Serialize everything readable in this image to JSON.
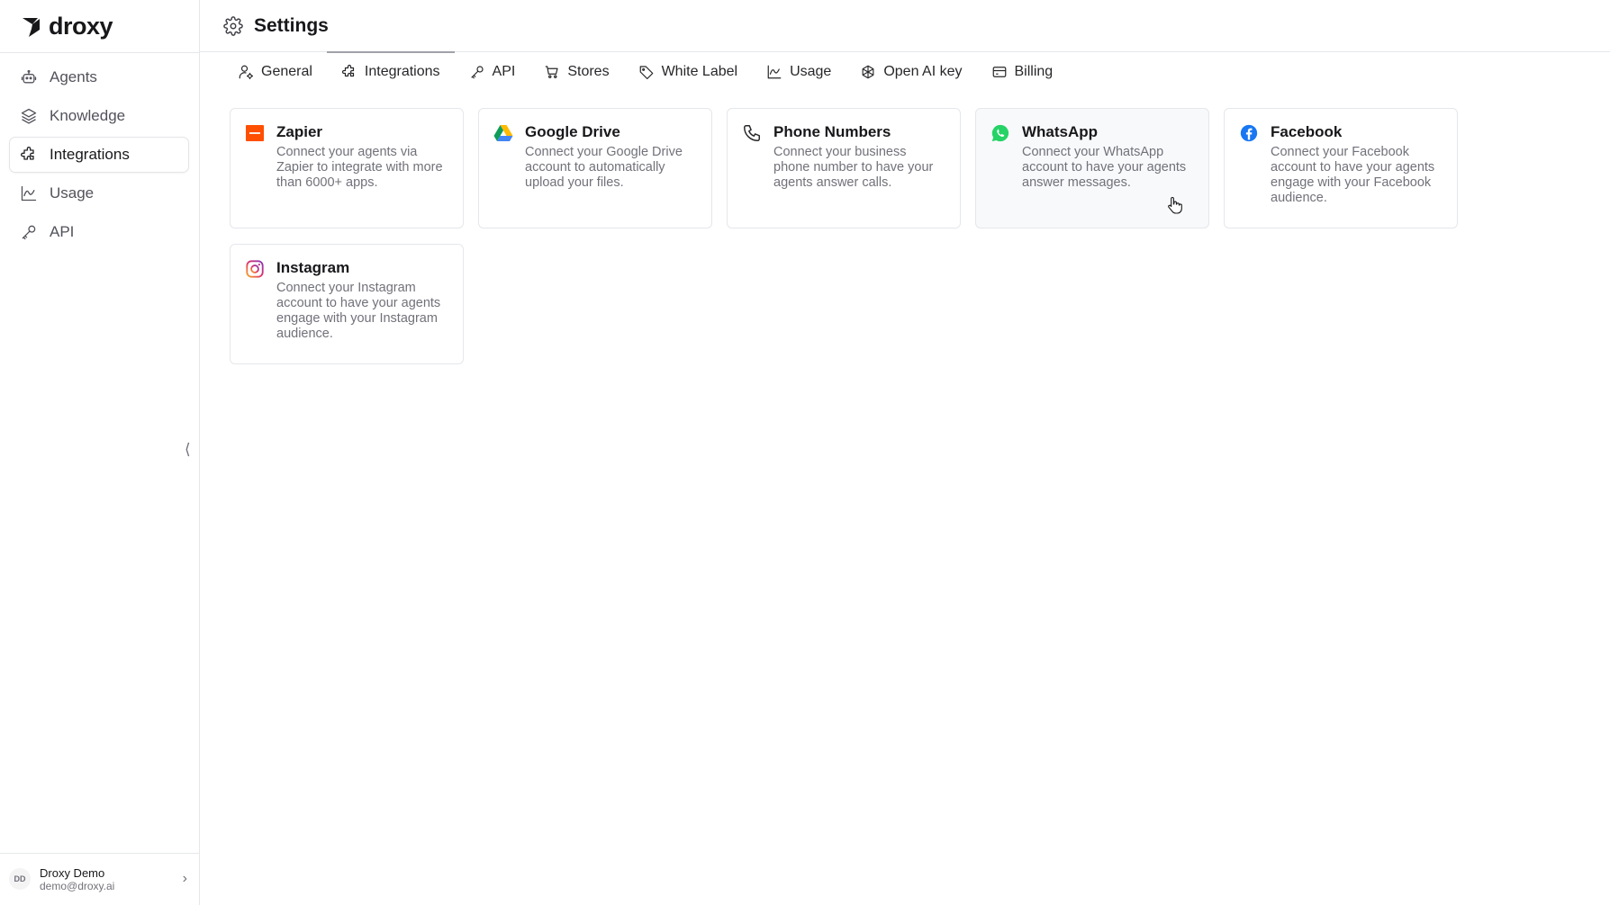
{
  "brand": {
    "name": "droxy"
  },
  "sidebar": {
    "items": [
      {
        "label": "Agents",
        "icon": "bot-icon",
        "active": false
      },
      {
        "label": "Knowledge",
        "icon": "layers-icon",
        "active": false
      },
      {
        "label": "Integrations",
        "icon": "puzzle-icon",
        "active": true
      },
      {
        "label": "Usage",
        "icon": "chart-icon",
        "active": false
      },
      {
        "label": "API",
        "icon": "key-icon",
        "active": false
      }
    ],
    "collapse_glyph": "⟨"
  },
  "user": {
    "initials": "DD",
    "name": "Droxy Demo",
    "email": "demo@droxy.ai"
  },
  "header": {
    "title": "Settings",
    "icon": "gear-icon"
  },
  "tabs": [
    {
      "label": "General",
      "icon": "user-gear-icon"
    },
    {
      "label": "Integrations",
      "icon": "puzzle-icon",
      "active": true
    },
    {
      "label": "API",
      "icon": "key-icon"
    },
    {
      "label": "Stores",
      "icon": "cart-icon"
    },
    {
      "label": "White Label",
      "icon": "tag-icon"
    },
    {
      "label": "Usage",
      "icon": "chart-icon"
    },
    {
      "label": "Open AI key",
      "icon": "openai-icon"
    },
    {
      "label": "Billing",
      "icon": "card-icon"
    }
  ],
  "integrations": [
    {
      "title": "Zapier",
      "description": "Connect your agents via Zapier to integrate with more than 6000+ apps.",
      "icon": "zapier-icon",
      "color": "#ff4f00"
    },
    {
      "title": "Google Drive",
      "description": "Connect your Google Drive account to automatically upload your files.",
      "icon": "google-drive-icon"
    },
    {
      "title": "Phone Numbers",
      "description": "Connect your business phone number to have your agents answer calls.",
      "icon": "phone-icon"
    },
    {
      "title": "WhatsApp",
      "description": "Connect your WhatsApp account to have your agents answer messages.",
      "icon": "whatsapp-icon",
      "color": "#25d366"
    },
    {
      "title": "Facebook",
      "description": "Connect your Facebook account to have your agents engage with your Facebook audience.",
      "icon": "facebook-icon",
      "color": "#1877f2"
    },
    {
      "title": "Instagram",
      "description": "Connect your Instagram account to have your agents engage with your Instagram audience.",
      "icon": "instagram-icon"
    }
  ]
}
